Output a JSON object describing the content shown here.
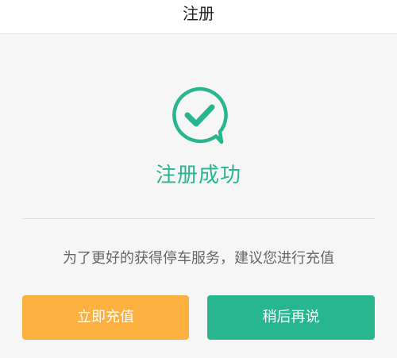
{
  "header": {
    "title": "注册"
  },
  "success": {
    "icon": "check-chat-bubble-icon",
    "title": "注册成功"
  },
  "message": {
    "text": "为了更好的获得停车服务，建议您进行充值"
  },
  "buttons": {
    "recharge_label": "立即充值",
    "later_label": "稍后再说"
  },
  "colors": {
    "accent_green": "#27b68f",
    "accent_orange": "#fbb040",
    "background": "#f6f6f6"
  }
}
